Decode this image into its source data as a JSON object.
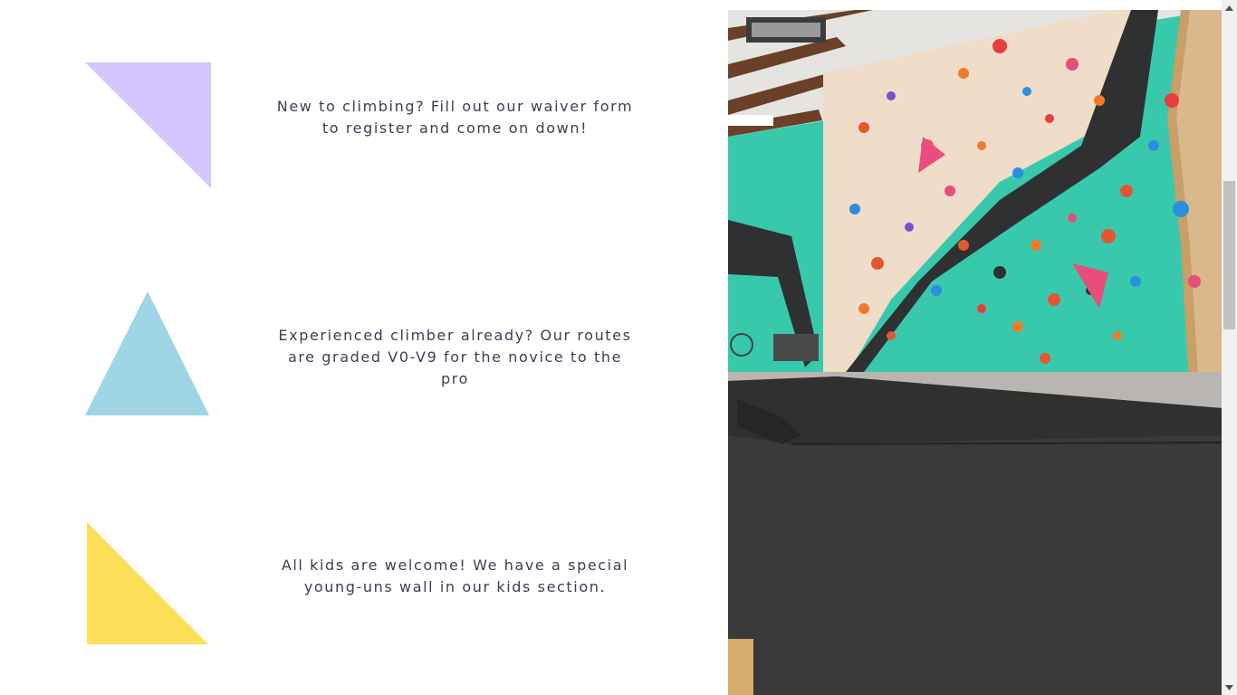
{
  "features": [
    {
      "icon": "purple-right-triangle-icon",
      "color": "#d3c6fd",
      "text": "New to climbing? Fill out our waiver form to register and come on down!"
    },
    {
      "icon": "blue-triangle-icon",
      "color": "#9fd5e4",
      "text": "Experienced climber already? Our routes are graded V0-V9 for the novice to the pro"
    },
    {
      "icon": "yellow-right-triangle-icon",
      "color": "#ffde5a",
      "text": "All kids are welcome! We have a special young-uns wall in our kids section."
    }
  ],
  "photo": {
    "icon": "climbing-gym-photo",
    "colors": {
      "teal_wall": "#38c9ad",
      "cream_wall": "#efdcc9",
      "black_stripe": "#2f3032",
      "mat": "#3a3a3a",
      "ceiling": "#e6e4e0",
      "wood": "#6a4028",
      "floor": "#b9b5b0"
    }
  },
  "scrollbar": {
    "up_icon": "scroll-up-arrow-icon",
    "down_icon": "scroll-down-arrow-icon"
  }
}
